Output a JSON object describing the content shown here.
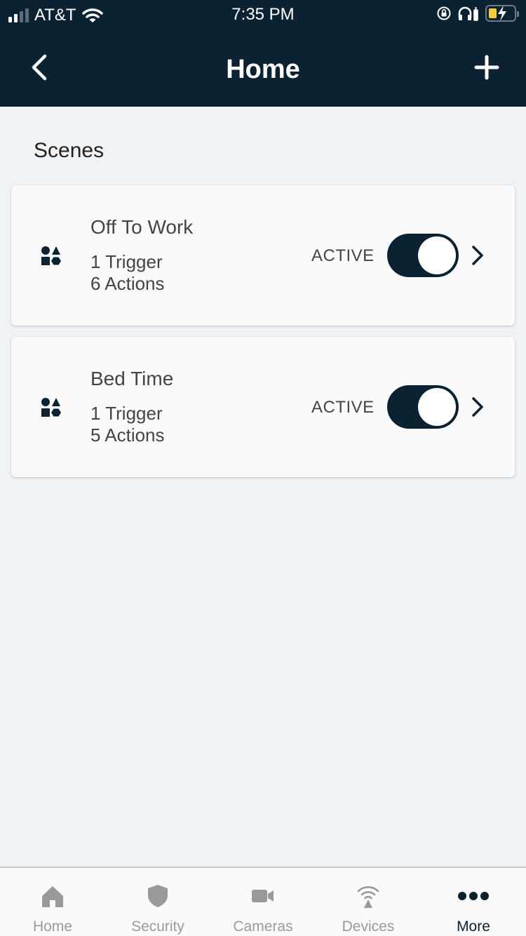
{
  "status_bar": {
    "carrier": "AT&T",
    "time": "7:35 PM",
    "signal_icon": "cellular-signal-icon",
    "wifi_icon": "wifi-icon",
    "orientation_lock_icon": "orientation-lock-icon",
    "headphones_icon": "headphones-icon",
    "battery_icon": "battery-charging-icon"
  },
  "header": {
    "title": "Home",
    "back_icon": "chevron-left-icon",
    "add_icon": "plus-icon",
    "background_color": "#0b2233"
  },
  "section": {
    "title": "Scenes"
  },
  "scenes": [
    {
      "name": "Off To Work",
      "triggers": "1 Trigger",
      "actions": "6 Actions",
      "status": "ACTIVE",
      "enabled": true,
      "icon": "shapes-icon"
    },
    {
      "name": "Bed Time",
      "triggers": "1 Trigger",
      "actions": "5 Actions",
      "status": "ACTIVE",
      "enabled": true,
      "icon": "shapes-icon"
    }
  ],
  "tabbar": {
    "items": [
      {
        "label": "Home",
        "icon": "home-icon",
        "active": false
      },
      {
        "label": "Security",
        "icon": "shield-icon",
        "active": false
      },
      {
        "label": "Cameras",
        "icon": "camera-icon",
        "active": false
      },
      {
        "label": "Devices",
        "icon": "wireless-icon",
        "active": false
      },
      {
        "label": "More",
        "icon": "more-dots-icon",
        "active": true
      }
    ],
    "active_color": "#0b2233",
    "inactive_color": "#9a9a9a"
  }
}
